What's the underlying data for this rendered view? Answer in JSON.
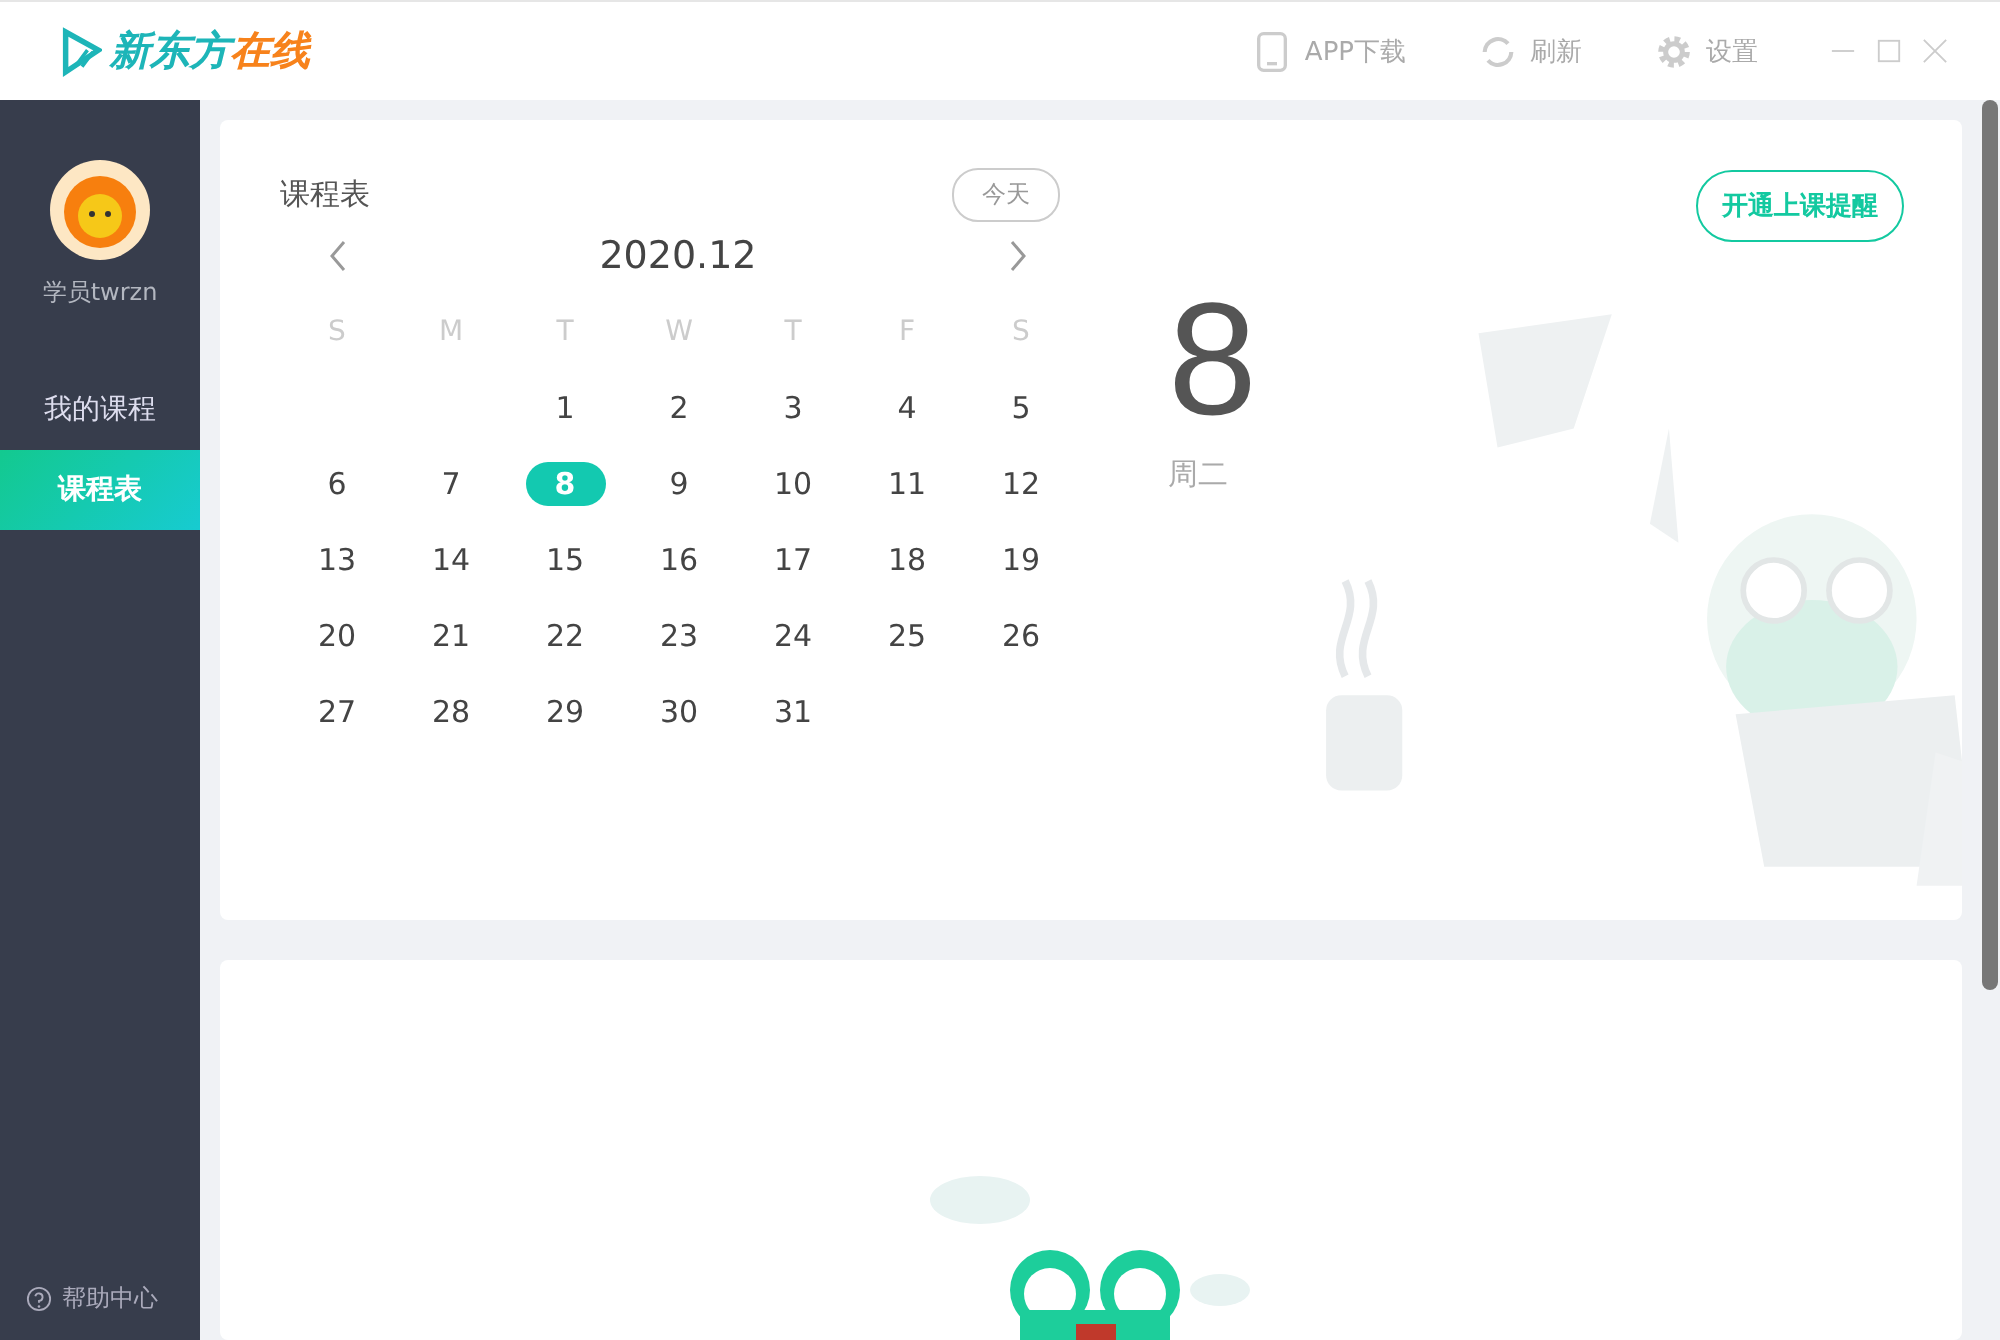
{
  "window": {
    "logo": {
      "part1": "新东方",
      "part2": "在线"
    },
    "actions": [
      {
        "kind": "phone",
        "label": "APP下载"
      },
      {
        "kind": "refresh",
        "label": "刷新"
      },
      {
        "kind": "gear",
        "label": "设置"
      }
    ]
  },
  "sidebar": {
    "user": "学员twrzn",
    "items": [
      {
        "label": "我的课程",
        "selected": false
      },
      {
        "label": "课程表",
        "selected": true
      }
    ],
    "help": "帮助中心"
  },
  "schedule": {
    "title": "课程表",
    "today_button": "今天",
    "reminder_button": "开通上课提醒",
    "month": "2020.12",
    "big_day": "8",
    "weekday": "周二",
    "weekdays": [
      "S",
      "M",
      "T",
      "W",
      "T",
      "F",
      "S"
    ],
    "weeks": [
      [
        {
          "day": "1",
          "selected": false
        },
        {
          "day": "2",
          "selected": false
        },
        {
          "day": "3",
          "selected": false
        },
        {
          "day": "4",
          "selected": false
        },
        {
          "day": "5",
          "selected": false
        }
      ],
      [
        {
          "day": "6",
          "selected": false
        },
        {
          "day": "7",
          "selected": false
        },
        {
          "day": "8",
          "selected": true
        },
        {
          "day": "9",
          "selected": false
        },
        {
          "day": "10",
          "selected": false
        },
        {
          "day": "11",
          "selected": false
        },
        {
          "day": "12",
          "selected": false
        }
      ],
      [
        {
          "day": "13",
          "selected": false
        },
        {
          "day": "14",
          "selected": false
        },
        {
          "day": "15",
          "selected": false
        },
        {
          "day": "16",
          "selected": false
        },
        {
          "day": "17",
          "selected": false
        },
        {
          "day": "18",
          "selected": false
        },
        {
          "day": "19",
          "selected": false
        }
      ],
      [
        {
          "day": "20",
          "selected": false
        },
        {
          "day": "21",
          "selected": false
        },
        {
          "day": "22",
          "selected": false
        },
        {
          "day": "23",
          "selected": false
        },
        {
          "day": "24",
          "selected": false
        },
        {
          "day": "25",
          "selected": false
        },
        {
          "day": "26",
          "selected": false
        }
      ],
      [
        {
          "day": "27",
          "selected": false
        },
        {
          "day": "28",
          "selected": false
        },
        {
          "day": "29",
          "selected": false
        },
        {
          "day": "30",
          "selected": false
        },
        {
          "day": "31",
          "selected": false
        }
      ]
    ]
  }
}
